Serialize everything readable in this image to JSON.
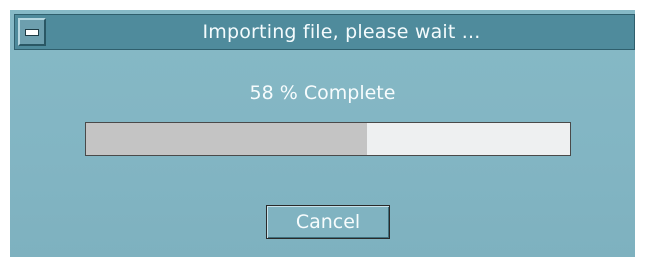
{
  "window": {
    "title": "Importing file, please wait ..."
  },
  "progress": {
    "status_text": "58 % Complete",
    "fraction": 0.58
  },
  "buttons": {
    "cancel_label": "Cancel"
  },
  "icons": {
    "system_menu": "system-menu-icon"
  },
  "colors": {
    "dialog_background": "#82b5c3",
    "titlebar": "#4f8b9c",
    "progress_fill": "#c4c4c4",
    "progress_track": "#eef0f1"
  }
}
